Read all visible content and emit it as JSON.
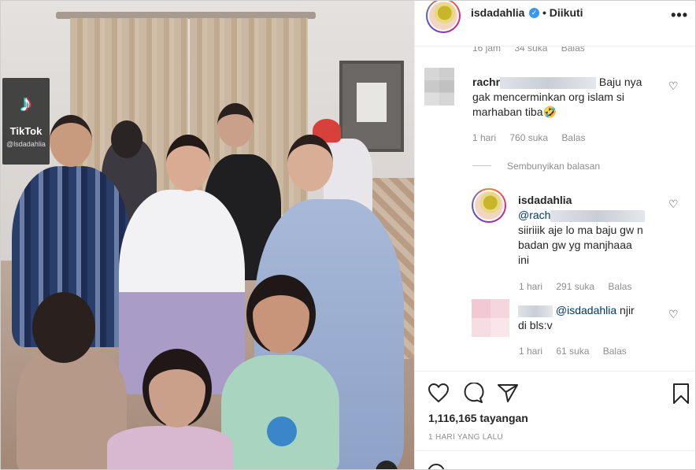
{
  "video": {
    "watermark_app": "TikTok",
    "watermark_handle": "@lsdadahlia"
  },
  "header": {
    "username": "isdadahlia",
    "separator": "•",
    "follow_state": "Diikuti",
    "more": "•••"
  },
  "comments": [
    {
      "time": "16 jam",
      "likes": "34 suka",
      "reply": "Balas"
    },
    {
      "username_visible": "rachr",
      "text_line1": "Baju nya",
      "text_line2": "gak mencerminkan org islam si",
      "text_line3": "marhaban tiba🤣",
      "time": "1 hari",
      "likes": "760 suka",
      "reply": "Balas",
      "hide_replies": "Sembunyikan balasan",
      "replies": [
        {
          "username": "isdadahlia",
          "mention": "@rach",
          "text_line1": "siiriiik aje lo ma baju gw n",
          "text_line2": "badan gw yg manjhaaa",
          "text_line3": "ini",
          "time": "1 hari",
          "likes": "291 suka",
          "reply": "Balas"
        },
        {
          "mention": "@isdadahlia",
          "text_line1": "njir",
          "text_line2": "di bls:v",
          "time": "1 hari",
          "likes": "61 suka",
          "reply": "Balas"
        }
      ]
    }
  ],
  "actions": {
    "views": "1,116,165 tayangan",
    "time_ago": "1 HARI YANG LALU"
  },
  "colors": {
    "text": "#262626",
    "muted": "#8e8e8e",
    "mention": "#00376b",
    "verified": "#3897f0"
  }
}
